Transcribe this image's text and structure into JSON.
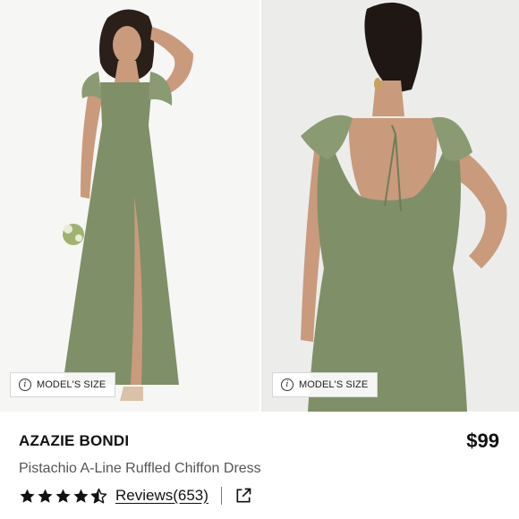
{
  "gallery": {
    "images": [
      {
        "alt": "front view",
        "size_label": "MODEL'S SIZE",
        "info_icon": "info-icon"
      },
      {
        "alt": "back view",
        "size_label": "MODEL'S SIZE",
        "info_icon": "info-icon"
      }
    ],
    "dress_color": "#7f8f68"
  },
  "product": {
    "brand": "AZAZIE BONDI",
    "price": "$99",
    "name": "Pistachio A-Line Ruffled Chiffon Dress",
    "rating": 4.5,
    "rating_max": 5,
    "reviews_label": "Reviews(653)",
    "share_icon": "external-link-icon"
  }
}
